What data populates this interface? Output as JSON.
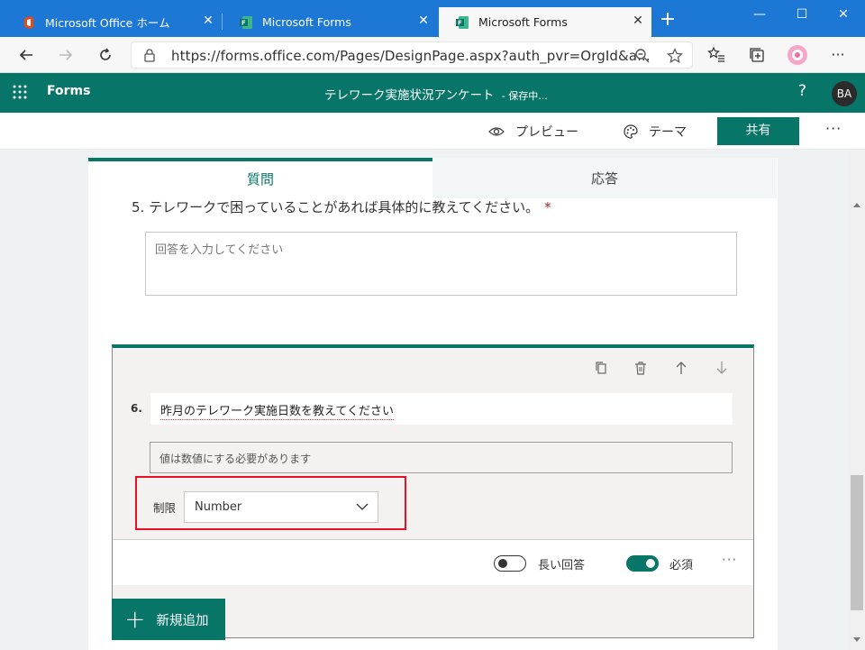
{
  "browser": {
    "tabs": [
      {
        "title": "Microsoft Office ホーム",
        "active": false
      },
      {
        "title": "Microsoft Forms",
        "active": false
      },
      {
        "title": "Microsoft Forms",
        "active": true
      }
    ],
    "url": "https://forms.office.com/Pages/DesignPage.aspx?auth_pvr=OrgId&a...",
    "new_tab_glyph": "+",
    "window_controls": {
      "minimize": "—",
      "maximize": "☐",
      "close": "✕"
    }
  },
  "forms_header": {
    "brand": "Forms",
    "form_title": "テレワーク実施状況アンケート",
    "status": "- 保存中...",
    "help": "?",
    "avatar_initials": "BA"
  },
  "command_bar": {
    "preview": "プレビュー",
    "theme": "テーマ",
    "share": "共有",
    "more": "···"
  },
  "tabs": {
    "questions": "質問",
    "responses": "応答"
  },
  "question5": {
    "number_title": "5. テレワークで困っていることがあれば具体的に教えてください。",
    "required_mark": "*",
    "answer_placeholder": "回答を入力してください"
  },
  "question6": {
    "number": "6.",
    "title": "昨月のテレワーク実施日数を教えてください",
    "hint": "値は数値にする必要があります",
    "restriction_label": "制限",
    "restriction_value": "Number",
    "long_answer_label": "長い回答",
    "long_answer_on": false,
    "required_label": "必須",
    "required_on": true,
    "more": "···"
  },
  "add_new": {
    "plus": "+",
    "label": "新規追加"
  },
  "colors": {
    "accent": "#077568",
    "browser_tabstrip": "#1d77d4",
    "highlight_box": "#e81123"
  }
}
